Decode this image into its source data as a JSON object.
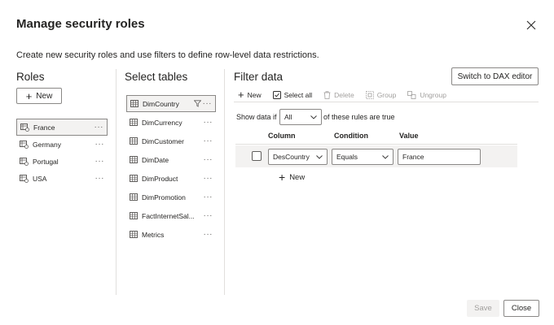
{
  "dialog": {
    "title": "Manage security roles",
    "description": "Create new security roles and use filters to define row-level data restrictions."
  },
  "roles": {
    "heading": "Roles",
    "new_label": "New",
    "items": [
      {
        "label": "France",
        "selected": true
      },
      {
        "label": "Germany",
        "selected": false
      },
      {
        "label": "Portugal",
        "selected": false
      },
      {
        "label": "USA",
        "selected": false
      }
    ]
  },
  "tables": {
    "heading": "Select tables",
    "items": [
      {
        "label": "DimCountry",
        "selected": true
      },
      {
        "label": "DimCurrency",
        "selected": false
      },
      {
        "label": "DimCustomer",
        "selected": false
      },
      {
        "label": "DimDate",
        "selected": false
      },
      {
        "label": "DimProduct",
        "selected": false
      },
      {
        "label": "DimPromotion",
        "selected": false
      },
      {
        "label": "FactInternetSal...",
        "selected": false
      },
      {
        "label": "Metrics",
        "selected": false
      }
    ]
  },
  "filter": {
    "heading": "Filter data",
    "dax_button": "Switch to DAX editor",
    "toolbar": {
      "new": "New",
      "select_all": "Select all",
      "delete": "Delete",
      "group": "Group",
      "ungroup": "Ungroup"
    },
    "show_data_prefix": "Show data if",
    "show_data_value": "All",
    "show_data_suffix": "of these rules are true",
    "columns": {
      "column": "Column",
      "condition": "Condition",
      "value": "Value"
    },
    "rule": {
      "column": "DesCountry",
      "condition": "Equals",
      "value": "France"
    },
    "add_rule": "New"
  },
  "footer": {
    "save": "Save",
    "close": "Close"
  }
}
